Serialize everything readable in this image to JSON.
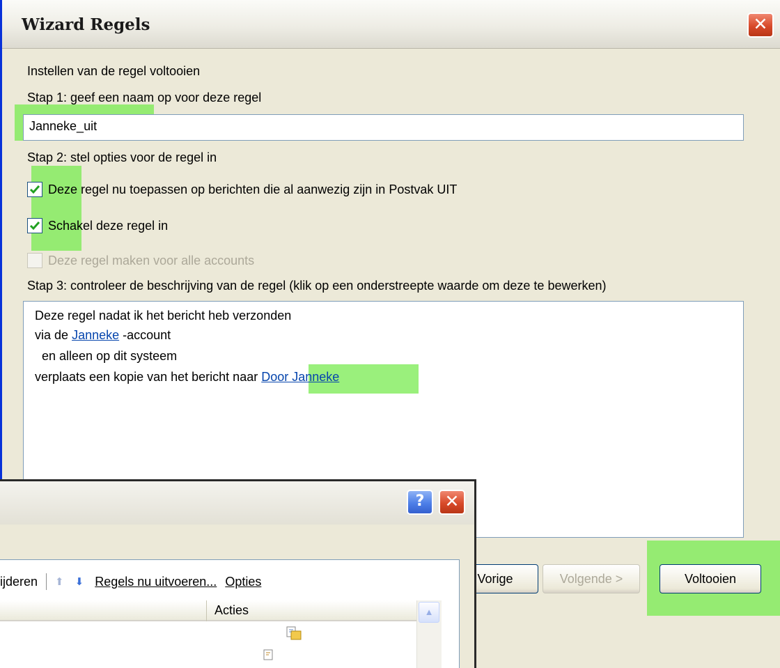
{
  "wizard": {
    "title": "Wizard Regels",
    "heading": "Instellen van de regel voltooien",
    "step1": "Stap 1: geef een naam op voor deze regel",
    "rule_name": "Janneke_uit",
    "step2": "Stap 2: stel opties voor de regel in",
    "options": [
      {
        "label": "Deze regel nu toepassen op berichten die al aanwezig zijn in Postvak UIT",
        "checked": true,
        "enabled": true
      },
      {
        "label": "Schakel deze regel in",
        "checked": true,
        "enabled": true
      },
      {
        "label": "Deze regel maken voor alle accounts",
        "checked": false,
        "enabled": false
      }
    ],
    "step3": "Stap 3: controleer de beschrijving van de regel (klik op een onderstreepte waarde om deze te bewerken)",
    "description": {
      "line1": "Deze regel nadat ik het bericht heb verzonden",
      "line2_prefix": "via de",
      "line2_link": "Janneke",
      "line2_suffix": "-account",
      "line3": "en alleen op dit systeem",
      "line4_prefix": "verplaats een kopie van het bericht naar",
      "line4_link": "Door Janneke"
    },
    "buttons": {
      "previous": "Vorige",
      "next": "Volgende >",
      "finish": "Voltooien"
    },
    "highlight_color": "#78eb50"
  },
  "rules_window": {
    "toolbar": {
      "change_partial": "ijderen",
      "run_rules": "Regels nu uitvoeren...",
      "options": "Opties"
    },
    "columns": {
      "actions": "Acties"
    }
  }
}
